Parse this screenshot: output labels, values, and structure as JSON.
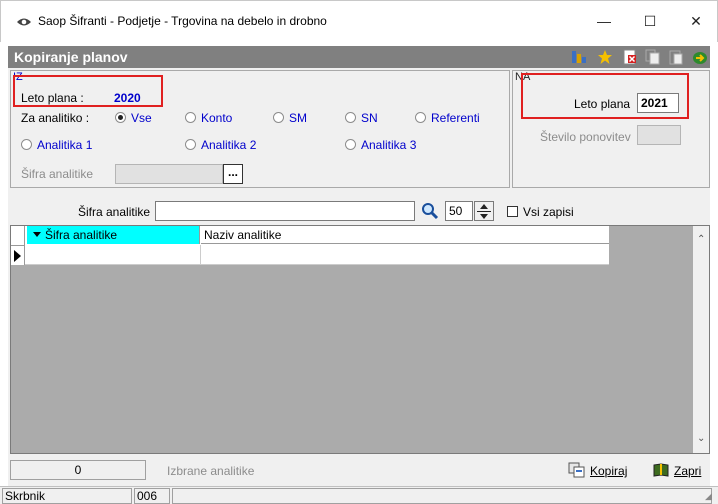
{
  "window": {
    "title": "Saop Šifranti - Podjetje - Trgovina na debelo in drobno",
    "minimize": "—",
    "maximize": "☐",
    "close": "✕"
  },
  "header": {
    "title": "Kopiranje planov"
  },
  "iz": {
    "group_label": "IZ",
    "leto_label": "Leto plana :",
    "leto_value": "2020",
    "za_analitiko_label": "Za analitiko :",
    "radios": [
      {
        "label": "Vse",
        "selected": true
      },
      {
        "label": "Konto",
        "selected": false
      },
      {
        "label": "SM",
        "selected": false
      },
      {
        "label": "SN",
        "selected": false
      },
      {
        "label": "Referenti",
        "selected": false
      },
      {
        "label": "Analitika 1",
        "selected": false
      },
      {
        "label": "Analitika 2",
        "selected": false
      },
      {
        "label": "Analitika 3",
        "selected": false
      }
    ],
    "sifra_label": "Šifra analitike",
    "browse_button": "..."
  },
  "na": {
    "group_label": "NA",
    "leto_label": "Leto plana",
    "leto_value": "2021",
    "stevilo_label": "Število ponovitev"
  },
  "search": {
    "label": "Šifra analitike",
    "value": "",
    "count": "50",
    "vsi_zapisi_label": "Vsi zapisi",
    "vsi_zapisi_checked": false
  },
  "grid": {
    "columns": [
      "Šifra analitike",
      "Naziv analitike"
    ],
    "rows": []
  },
  "footer": {
    "count": "0",
    "selected_label": "Izbrane analitike",
    "kopiraj_label": "Kopiraj",
    "zapri_label": "Zapri"
  },
  "statusbar": {
    "user": "Skrbnik",
    "code": "006"
  },
  "colors": {
    "header_bg": "#808080",
    "accent_blue": "#0000cc",
    "column_highlight": "#00ffff",
    "annotation_red": "#e02020"
  }
}
